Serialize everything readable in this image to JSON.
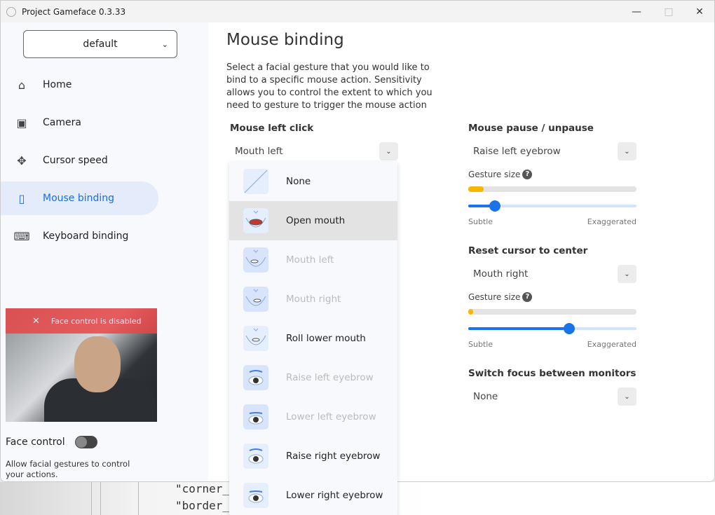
{
  "window": {
    "title": "Project Gameface 0.3.33"
  },
  "sidebar": {
    "profile": "default",
    "items": [
      {
        "label": "Home",
        "icon": "home-icon",
        "active": false
      },
      {
        "label": "Camera",
        "icon": "camera-icon",
        "active": false
      },
      {
        "label": "Cursor speed",
        "icon": "move-icon",
        "active": false
      },
      {
        "label": "Mouse binding",
        "icon": "mouse-icon",
        "active": true
      },
      {
        "label": "Keyboard binding",
        "icon": "keyboard-icon",
        "active": false
      }
    ],
    "camera_banner": "Face control is disabled",
    "face_control": {
      "label": "Face control",
      "enabled": false,
      "description": "Allow facial gestures to control your actions."
    }
  },
  "main": {
    "title": "Mouse binding",
    "description": "Select a facial gesture that you would like to bind to a specific mouse action. Sensitivity allows you to control  the extent to which you need to gesture to trigger the mouse action",
    "left_click": {
      "label": "Mouse left click",
      "value": "Mouth left"
    },
    "bindings": [
      {
        "label": "Mouse pause / unpause",
        "value": "Raise left eyebrow",
        "gesture_label": "Gesture size",
        "help": "?",
        "current_level": 0.09,
        "sensitivity": 0.16,
        "min_label": "Subtle",
        "max_label": "Exaggerated"
      },
      {
        "label": "Reset cursor to center",
        "value": "Mouth right",
        "gesture_label": "Gesture size",
        "help": "?",
        "current_level": 0.03,
        "sensitivity": 0.6,
        "min_label": "Subtle",
        "max_label": "Exaggerated"
      },
      {
        "label": "Switch focus between monitors",
        "value": "None"
      }
    ],
    "dropdown_options": [
      {
        "label": "None",
        "state": "normal"
      },
      {
        "label": "Open mouth",
        "state": "highlighted"
      },
      {
        "label": "Mouth left",
        "state": "disabled"
      },
      {
        "label": "Mouth right",
        "state": "disabled"
      },
      {
        "label": "Roll lower mouth",
        "state": "normal"
      },
      {
        "label": "Raise left eyebrow",
        "state": "disabled"
      },
      {
        "label": "Lower left eyebrow",
        "state": "disabled"
      },
      {
        "label": "Raise right eyebrow",
        "state": "normal"
      },
      {
        "label": "Lower right eyebrow",
        "state": "normal"
      }
    ]
  },
  "background_text": [
    "\"corner_r",
    "\"border_w"
  ],
  "colors": {
    "accent": "#1a73e8",
    "level": "#f5b800",
    "banner": "#e64646"
  }
}
